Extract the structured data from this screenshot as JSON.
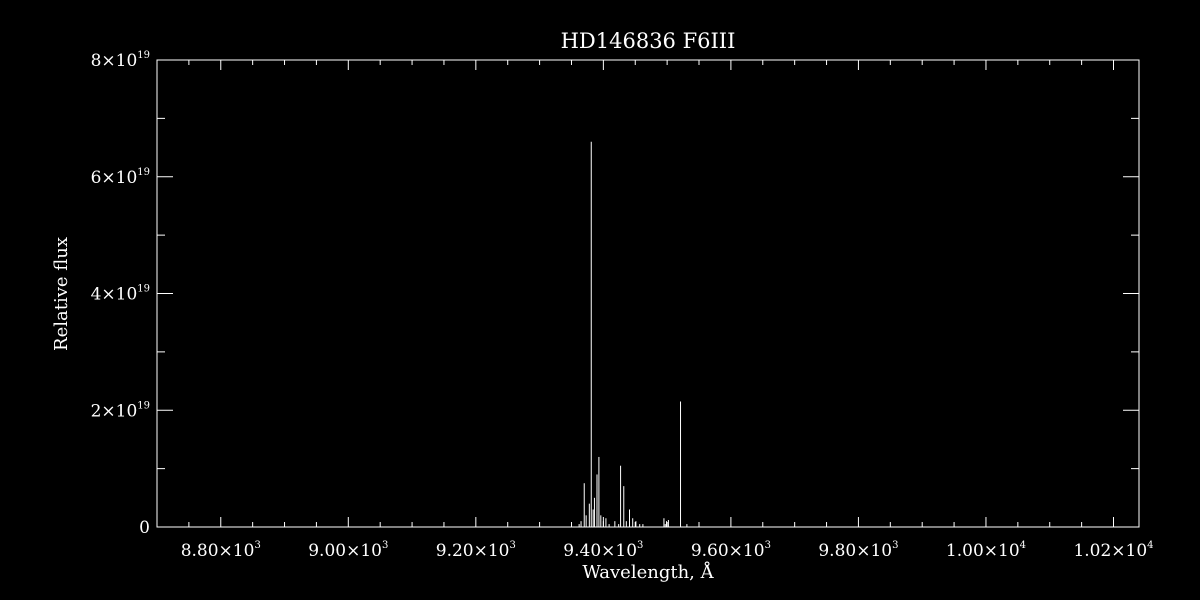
{
  "chart_data": {
    "type": "line",
    "title": "HD146836   F6III",
    "xlabel": "Wavelength, Å",
    "ylabel": "Relative flux",
    "xlim": [
      8700,
      10240
    ],
    "ylim": [
      0,
      8e+19
    ],
    "xticks": [
      {
        "value": 8800,
        "mant": "8.80×10",
        "exp": "3"
      },
      {
        "value": 9000,
        "mant": "9.00×10",
        "exp": "3"
      },
      {
        "value": 9200,
        "mant": "9.20×10",
        "exp": "3"
      },
      {
        "value": 9400,
        "mant": "9.40×10",
        "exp": "3"
      },
      {
        "value": 9600,
        "mant": "9.60×10",
        "exp": "3"
      },
      {
        "value": 9800,
        "mant": "9.80×10",
        "exp": "3"
      },
      {
        "value": 10000,
        "mant": "1.00×10",
        "exp": "4"
      },
      {
        "value": 10200,
        "mant": "1.02×10",
        "exp": "4"
      }
    ],
    "yticks": [
      {
        "value": 0,
        "mant": "0",
        "exp": ""
      },
      {
        "value": 2e+19,
        "mant": "2×10",
        "exp": "19"
      },
      {
        "value": 4e+19,
        "mant": "4×10",
        "exp": "19"
      },
      {
        "value": 6e+19,
        "mant": "6×10",
        "exp": "19"
      },
      {
        "value": 8e+19,
        "mant": "8×10",
        "exp": "19"
      }
    ],
    "x_minor_step": 50,
    "y_minor_step": 1e+19,
    "series": [
      {
        "x": [
          9362,
          9365,
          9370,
          9373,
          9378,
          9381,
          9384,
          9386,
          9390,
          9393,
          9396,
          9400,
          9404,
          9409,
          9418,
          9424,
          9427,
          9432,
          9436,
          9441,
          9446,
          9451,
          9457,
          9462,
          9495,
          9497,
          9499,
          9502,
          9521,
          9531
        ],
        "y": [
          5e+17,
          1e+18,
          7.5e+18,
          2e+18,
          4e+18,
          6.6e+19,
          3e+18,
          5e+18,
          9e+18,
          1.2e+19,
          2e+18,
          1e+18,
          1.5e+18,
          5e+17,
          1e+18,
          5e+17,
          1.05e+19,
          7e+18,
          1e+18,
          3e+18,
          1.5e+18,
          1e+18,
          5e+17,
          5e+17,
          1.5e+18,
          5e+17,
          1e+18,
          1.2e+18,
          2.15e+19,
          5e+17
        ]
      }
    ]
  }
}
